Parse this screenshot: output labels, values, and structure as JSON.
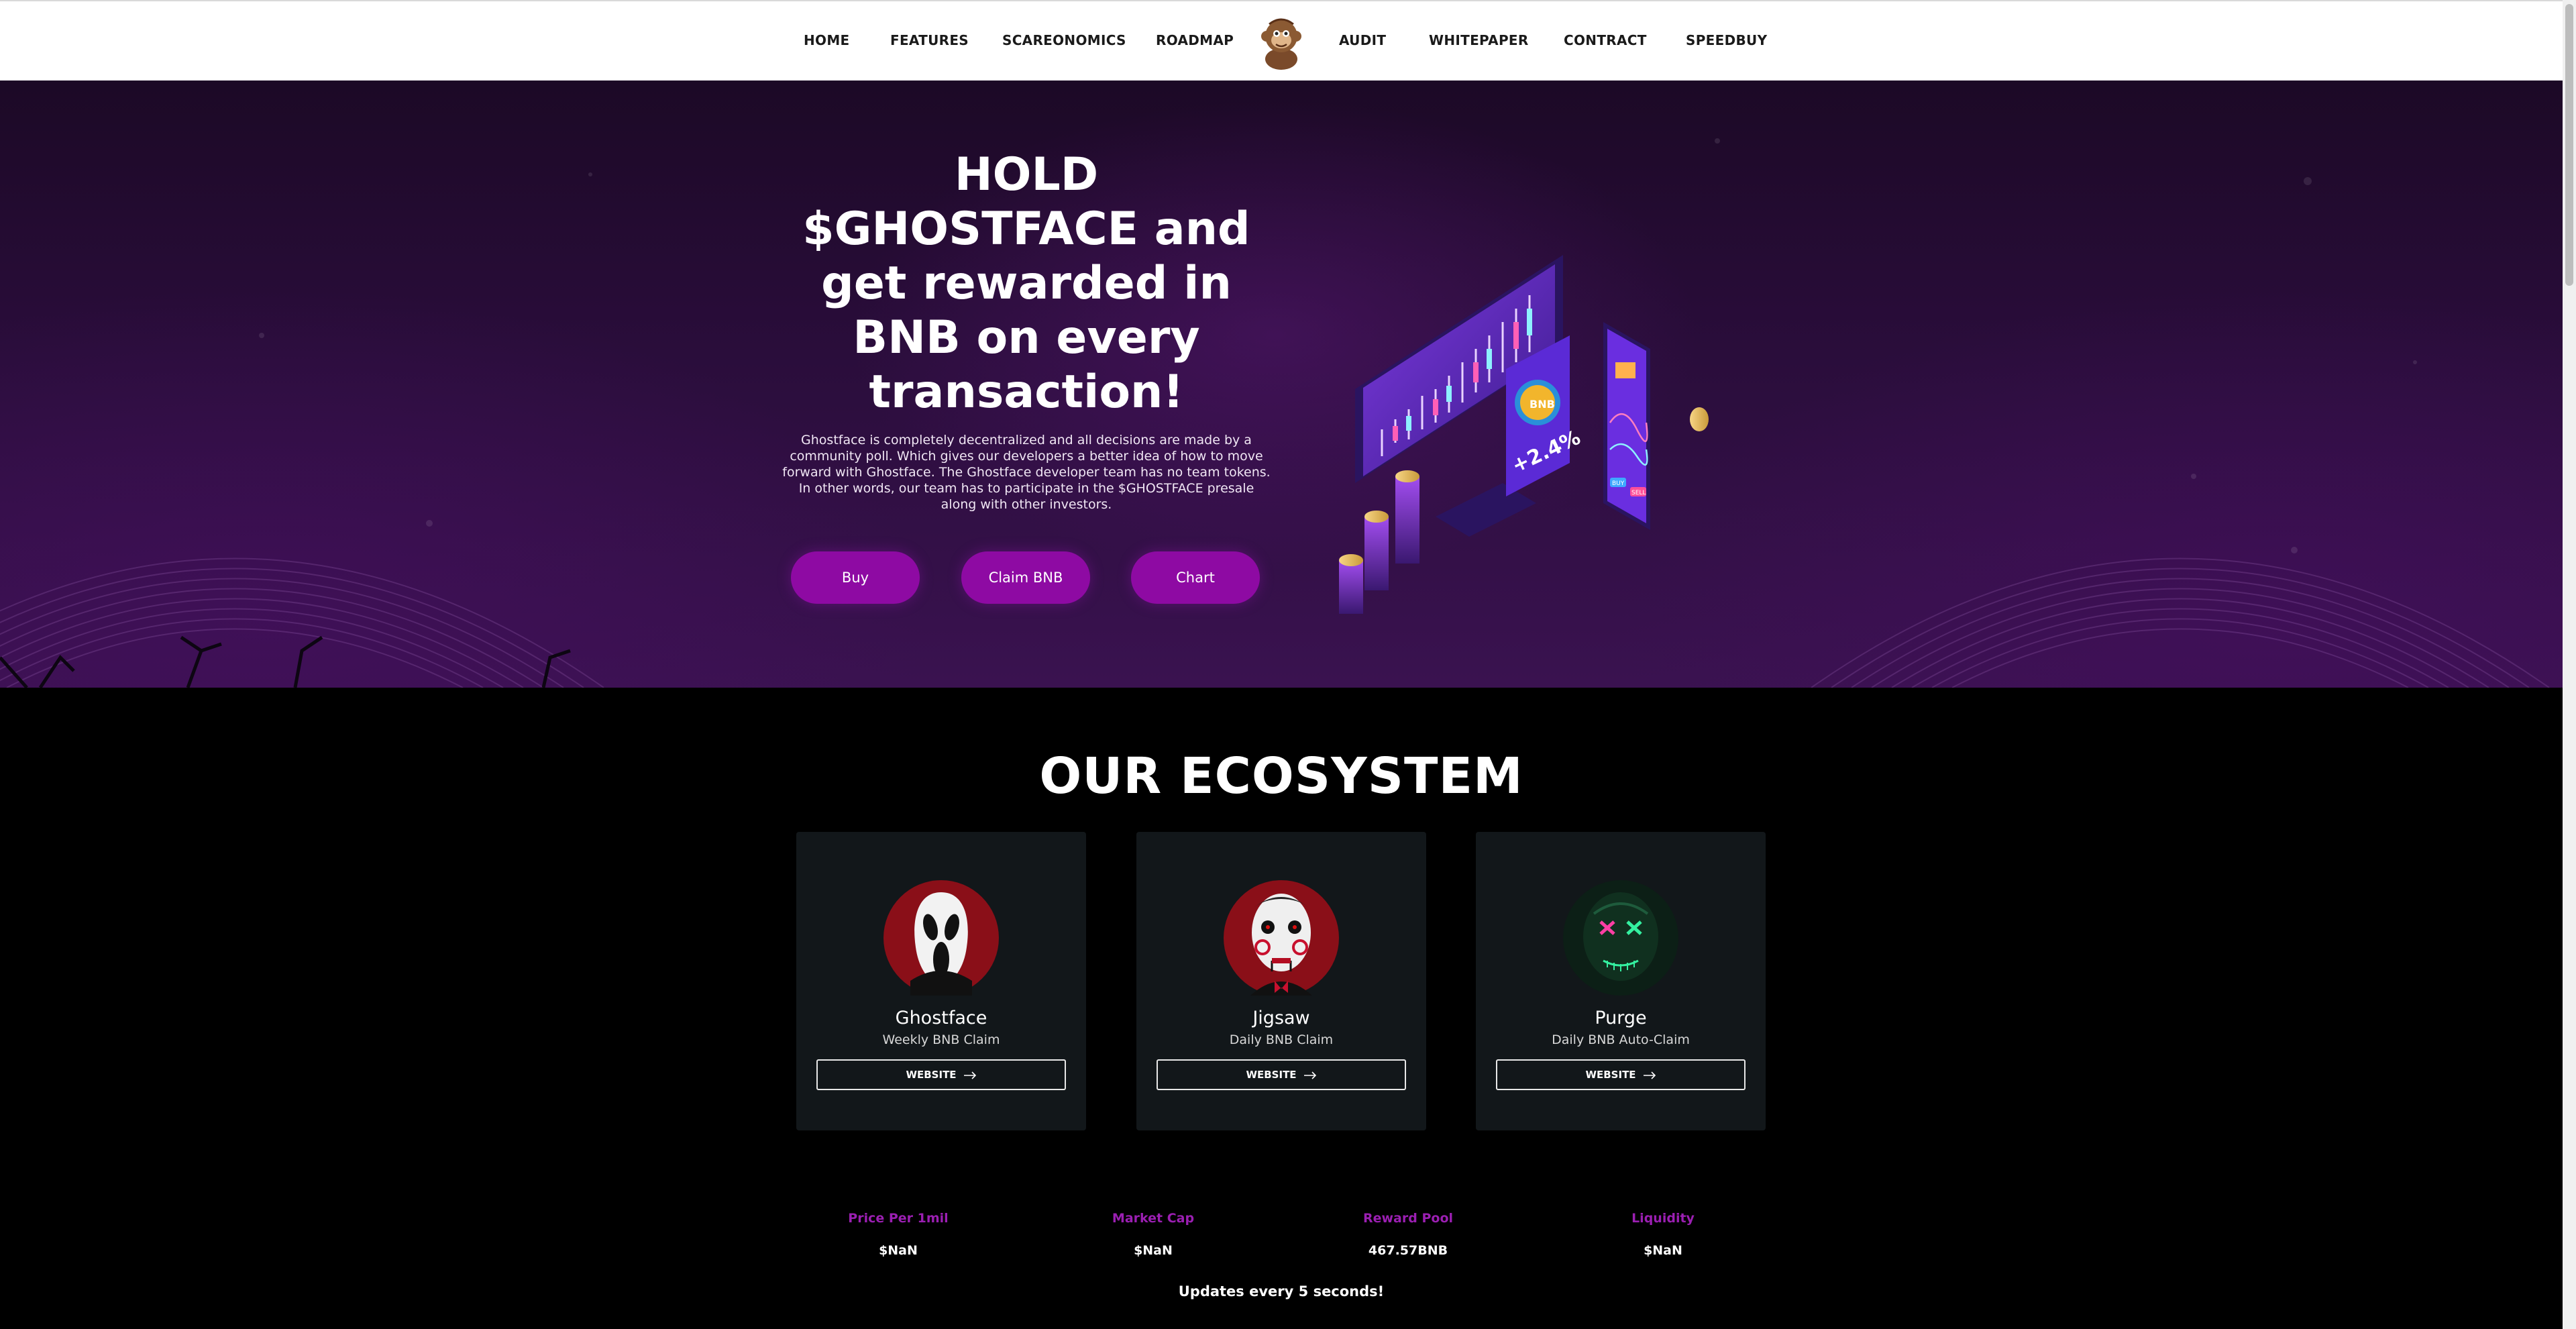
{
  "nav": {
    "items": [
      "HOME",
      "FEATURES",
      "SCAREONOMICS",
      "ROADMAP",
      "AUDIT",
      "WHITEPAPER",
      "CONTRACT",
      "SPEEDBUY"
    ],
    "logo_icon": "monkey-mascot-icon"
  },
  "hero": {
    "title": "HOLD $GHOSTFACE and get rewarded in BNB on every transaction!",
    "description": "Ghostface is completely decentralized and all decisions are made by a community poll. Which gives our developers a better idea of how to move forward with Ghostface. The Ghostface developer team has no team tokens. In other words, our team has to participate in the $GHOSTFACE presale along with other investors.",
    "buttons": [
      "Buy",
      "Claim BNB",
      "Chart"
    ],
    "illustration": {
      "coin_label": "BNB",
      "percent": "+2.4%",
      "phone_buttons": [
        "BUY",
        "SELL"
      ]
    },
    "colors": {
      "accent": "#8e0aa3",
      "bg": "#2a0d3b"
    }
  },
  "ecosystem": {
    "title": "OUR ECOSYSTEM",
    "cards": [
      {
        "name": "Ghostface",
        "subtitle": "Weekly BNB Claim",
        "button": "WEBSITE",
        "avatar_icon": "ghostface-mask-icon"
      },
      {
        "name": "Jigsaw",
        "subtitle": "Daily BNB Claim",
        "button": "WEBSITE",
        "avatar_icon": "jigsaw-puppet-icon"
      },
      {
        "name": "Purge",
        "subtitle": "Daily BNB Auto-Claim",
        "button": "WEBSITE",
        "avatar_icon": "purge-mask-icon"
      }
    ]
  },
  "stats": {
    "items": [
      {
        "label": "Price Per 1mil",
        "value": "$NaN"
      },
      {
        "label": "Market Cap",
        "value": "$NaN"
      },
      {
        "label": "Reward Pool",
        "value": "467.57BNB"
      },
      {
        "label": "Liquidity",
        "value": "$NaN"
      }
    ],
    "updates_note": "Updates every 5 seconds!"
  }
}
